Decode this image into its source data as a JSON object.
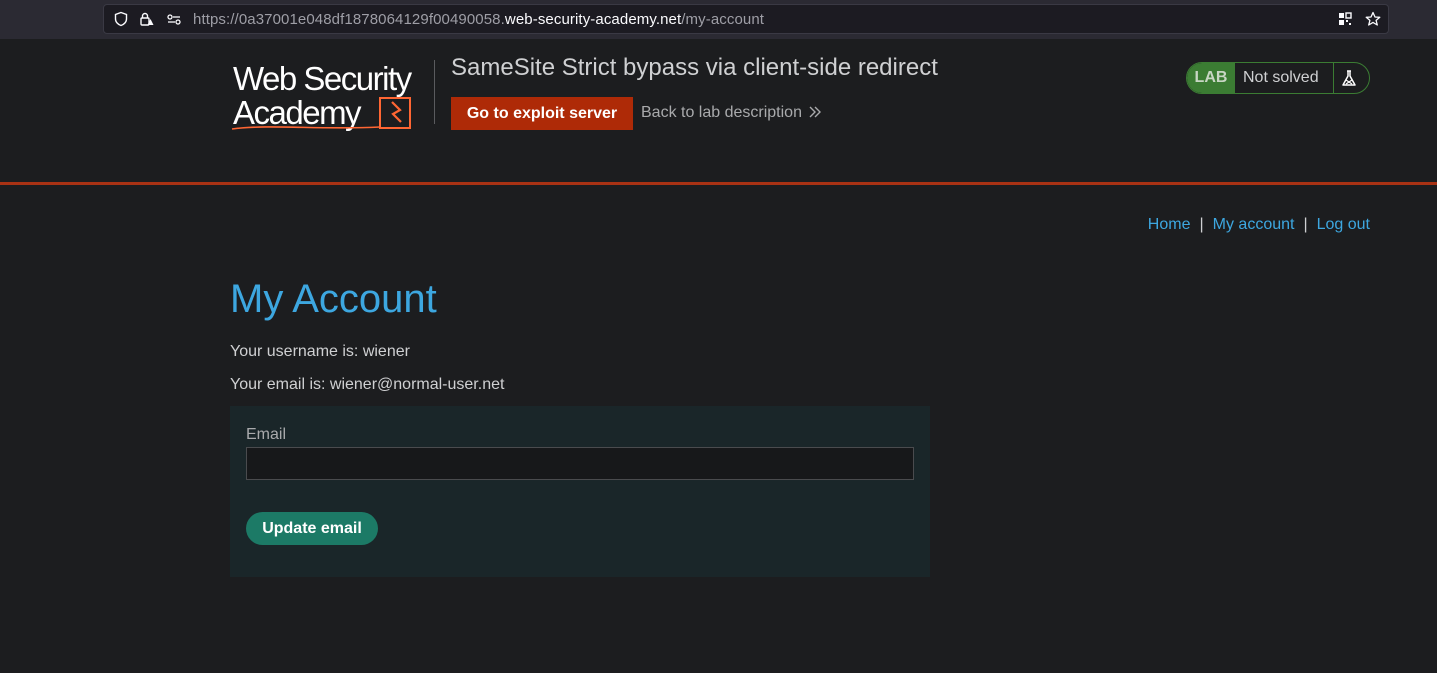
{
  "browser": {
    "url_prefix": "https://0a37001e048df1878064129f00490058.",
    "url_domain": "web-security-academy.net",
    "url_path": "/my-account"
  },
  "header": {
    "logo_line1": "Web Security",
    "logo_line2": "Academy",
    "lab_title": "SameSite Strict bypass via client-side redirect",
    "exploit_button": "Go to exploit server",
    "back_link": "Back to lab description",
    "lab_tag": "LAB",
    "lab_state": "Not solved"
  },
  "nav": {
    "home": "Home",
    "separator": "|",
    "my_account": "My account",
    "log_out": "Log out"
  },
  "main": {
    "title": "My Account",
    "username_line": "Your username is: wiener",
    "email_line": "Your email is: wiener@normal-user.net",
    "form": {
      "email_label": "Email",
      "email_value": "",
      "submit_label": "Update email"
    }
  },
  "colors": {
    "accent_blue": "#3da7e0",
    "exploit_red": "#ae2a07",
    "lab_green": "#3b7c33",
    "update_teal": "#1c7a66",
    "header_rule": "#a83214"
  }
}
